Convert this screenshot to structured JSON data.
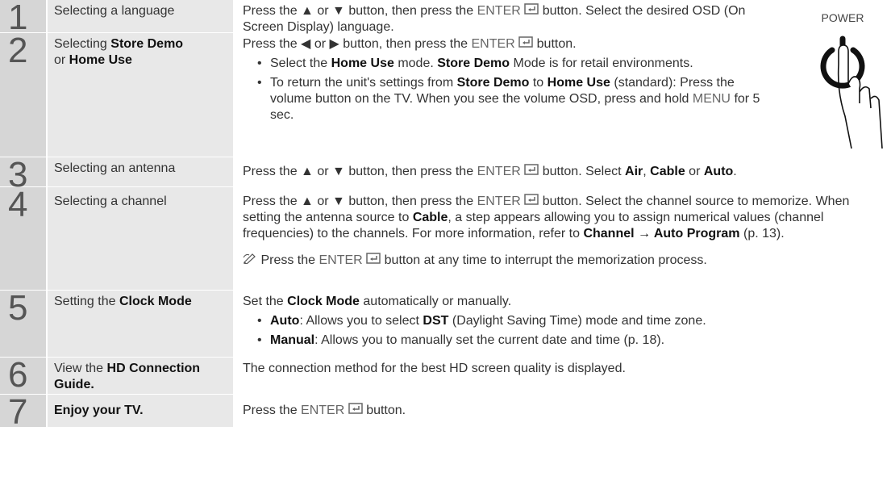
{
  "power_label": "POWER",
  "steps": [
    {
      "num": "1",
      "name": "Selecting a language"
    },
    {
      "num": "2",
      "name_a": "Selecting ",
      "name_b": "Store Demo",
      "name_c": " or ",
      "name_d": "Home Use"
    },
    {
      "num": "3",
      "name": "Selecting an antenna"
    },
    {
      "num": "4",
      "name": "Selecting a channel"
    },
    {
      "num": "5",
      "name_a": "Setting the ",
      "name_b": "Clock Mode"
    },
    {
      "num": "6",
      "name_a": "View the ",
      "name_b": "HD Connection Guide."
    },
    {
      "num": "7",
      "name": "Enjoy your TV."
    }
  ],
  "text": {
    "press": "Press the",
    "or": "or",
    "up": "▲",
    "down": "▼",
    "left": "◀",
    "right": "▶",
    "then": "button, then press the",
    "enter": "ENTER",
    "button": "button.",
    "s1_tail": "Select the desired OSD (On Screen Display) language.",
    "s2_b1_a": "Select the",
    "s2_b1_b": "Home Use",
    "s2_b1_c": "mode.",
    "s2_b1_d": "Store Demo",
    "s2_b1_e": "Mode is for retail environments.",
    "s2_b2_a": "To return the unit's settings from",
    "s2_b2_b": "Store Demo",
    "s2_b2_c": "to",
    "s2_b2_d": "Home Use",
    "s2_b2_e": "(standard): Press the volume button on the TV. When you see the volume OSD, press and hold",
    "s2_b2_f": "MENU",
    "s2_b2_g": "for 5 sec.",
    "s3_tail": "Select",
    "air": "Air",
    "cable": "Cable",
    "auto": "Auto",
    "s4_tail": "Select the channel source to memorize. When setting the antenna source to",
    "s4_tail2": ", a step appears allowing you to assign numerical values (channel frequencies) to the channels. For more information, refer to",
    "s4_ref_a": "Channel → Auto Program",
    "s4_ref_b": "(p. 13).",
    "s4_note_a": "Press the",
    "s4_note_b": "button at any time to interrupt the memorization process.",
    "s5_intro_a": "Set the",
    "s5_intro_b": "Clock Mode",
    "s5_intro_c": "automatically or manually.",
    "s5_b1_a": "Auto",
    "s5_b1_b": ": Allows you to select",
    "s5_b1_c": "DST",
    "s5_b1_d": "(Daylight Saving Time) mode and time zone.",
    "s5_b2_a": "Manual",
    "s5_b2_b": ": Allows you to manually set the current date and time (p. 18).",
    "s6": "The connection method for the best HD screen quality is displayed.",
    "s7_a": "Press the",
    "s7_b": "button."
  }
}
